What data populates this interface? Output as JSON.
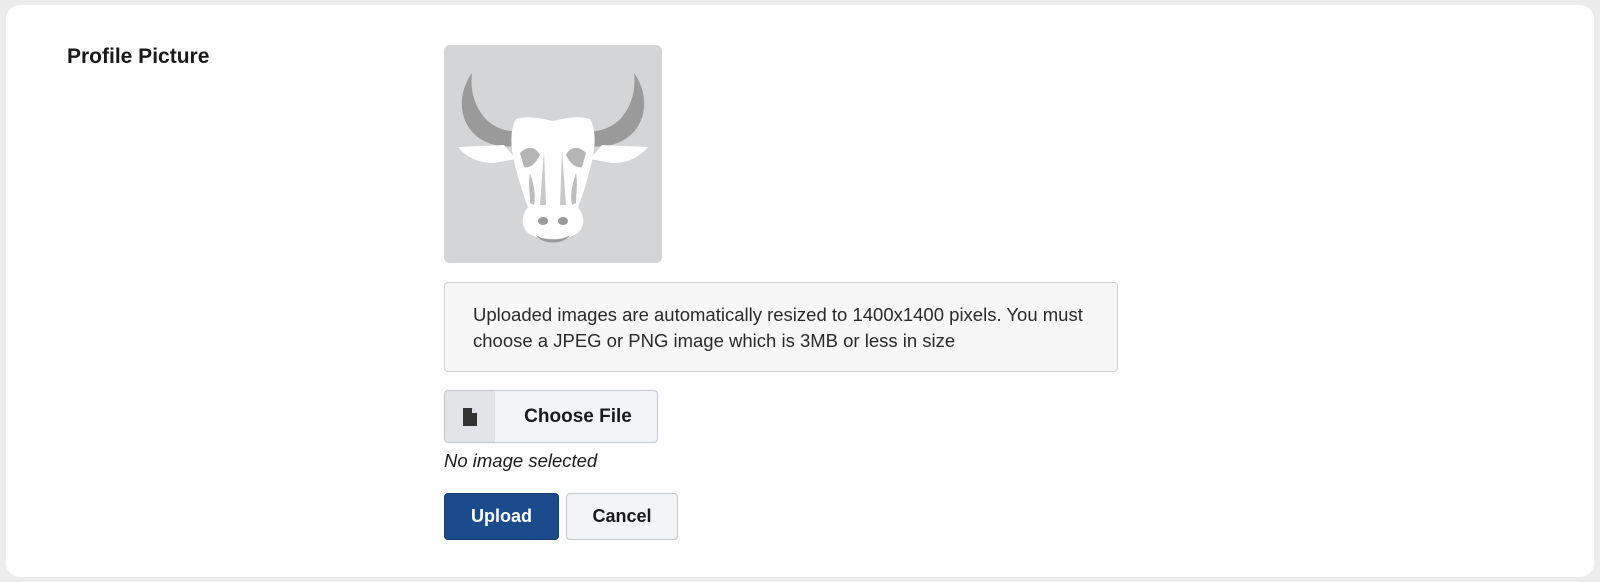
{
  "profile": {
    "section_label": "Profile Picture",
    "avatar_icon": "bull-head-icon",
    "info_text": "Uploaded images are automatically resized to 1400x1400 pixels. You must choose a JPEG or PNG image which is 3MB or less in size",
    "file_button_icon": "file-icon",
    "choose_file_label": "Choose File",
    "no_image_text": "No image selected",
    "upload_label": "Upload",
    "cancel_label": "Cancel"
  },
  "colors": {
    "page_background": "#ececec",
    "card_background": "#ffffff",
    "avatar_background": "#d4d5d7",
    "primary_button": "#1c4b8c",
    "secondary_button": "#f3f4f6",
    "info_background": "#f7f7f7"
  }
}
